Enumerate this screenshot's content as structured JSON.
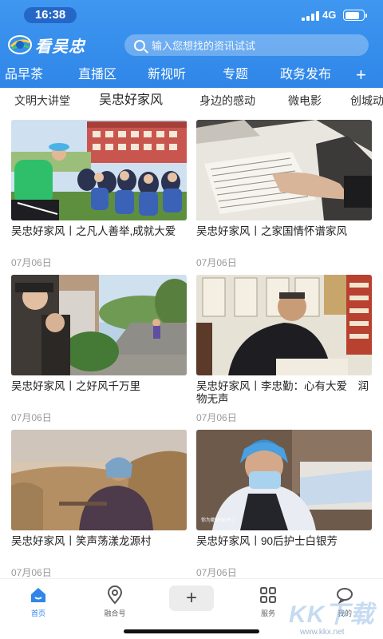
{
  "status_bar": {
    "time": "16:38",
    "network": "4G"
  },
  "app": {
    "logo_text": "看吴忠"
  },
  "search": {
    "placeholder": "输入您想找的资讯试试"
  },
  "channels": [
    "品早茶",
    "直播区",
    "新视听",
    "专题",
    "政务发布"
  ],
  "channel_more_icon": "plus-icon",
  "subtabs": [
    "文明大讲堂",
    "吴忠好家风",
    "身边的感动",
    "微电影",
    "创城动"
  ],
  "active_subtab": "吴忠好家风",
  "articles": [
    {
      "title": "吴忠好家风丨之凡人善举,成就大爱",
      "date": "07月06日"
    },
    {
      "title": "吴忠好家风丨之家国情怀谱家风",
      "date": "07月06日"
    },
    {
      "title": "吴忠好家风丨之好风千万里",
      "date": "07月06日"
    },
    {
      "title": "吴忠好家风丨李忠勤：心有大爱　润物无声",
      "date": "07月06日"
    },
    {
      "title": "吴忠好家风丨笑声荡漾龙源村",
      "date": "07月06日"
    },
    {
      "title": "吴忠好家风丨90后护士白银芳",
      "date": "07月06日"
    }
  ],
  "image_captions": {
    "nurse_photo": "你为都转90天了"
  },
  "bottom_nav": {
    "items": [
      {
        "label": "首页",
        "icon": "home-icon"
      },
      {
        "label": "融合号",
        "icon": "location-pin-icon"
      },
      {
        "label": "服务",
        "icon": "grid-icon"
      },
      {
        "label": "我的",
        "icon": "chat-bubble-icon"
      }
    ],
    "publish_label": "+"
  },
  "watermark": {
    "brand": "KK下载",
    "url": "www.kkx.net"
  },
  "colors": {
    "brand_blue": "#2f86e8",
    "header_blue": "#3f97f0"
  }
}
